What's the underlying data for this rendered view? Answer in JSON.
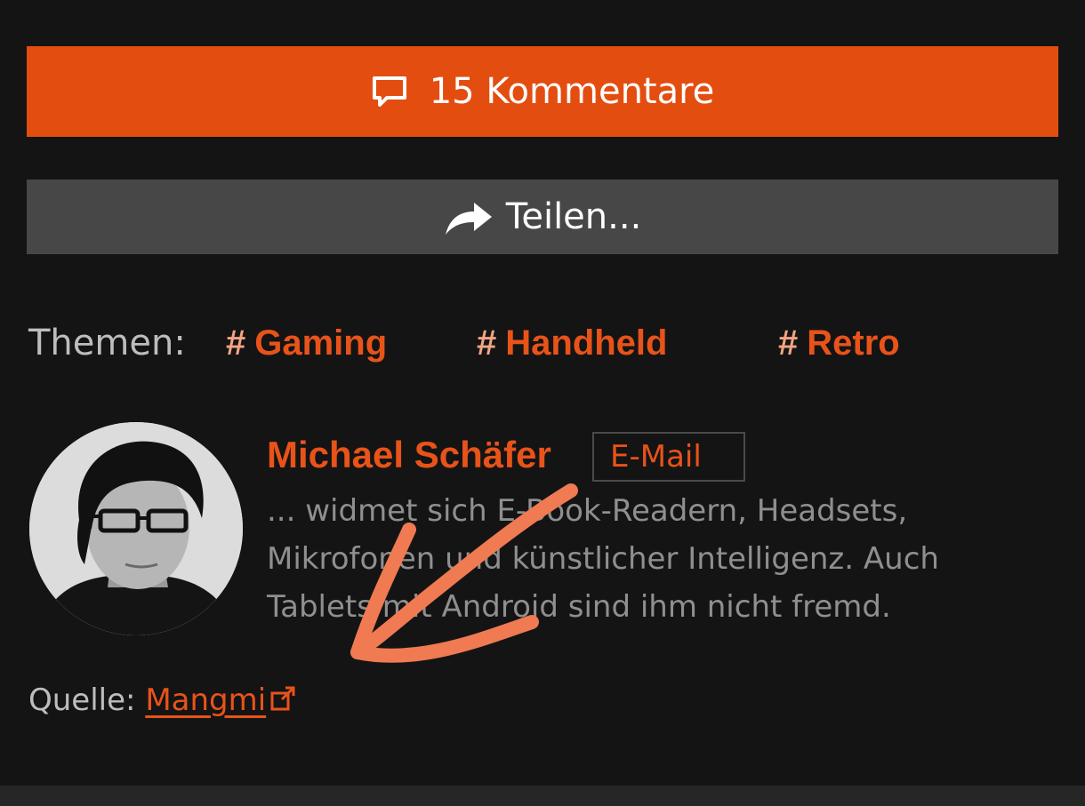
{
  "comments_button": {
    "label": "15 Kommentare",
    "icon": "comment-icon"
  },
  "share_button": {
    "label": "Teilen...",
    "icon": "share-arrow-icon"
  },
  "topics": {
    "label": "Themen:",
    "tags": [
      {
        "hash": "#",
        "name": "Gaming"
      },
      {
        "hash": "#",
        "name": "Handheld"
      },
      {
        "hash": "#",
        "name": "Retro"
      }
    ]
  },
  "author": {
    "name": "Michael Schäfer",
    "email_label": "E-Mail",
    "bio": "... widmet sich E-Book-Readern, Headsets, Mikrofonen und künstlicher Intelligenz. Auch Tablets mit Android sind ihm nicht fremd."
  },
  "source": {
    "label": "Quelle:",
    "link_text": "Mangmi",
    "icon": "external-link-icon"
  },
  "colors": {
    "background": "#141414",
    "accent": "#e44d10",
    "share_button": "#474747",
    "annotation_arrow": "#f07a52"
  }
}
